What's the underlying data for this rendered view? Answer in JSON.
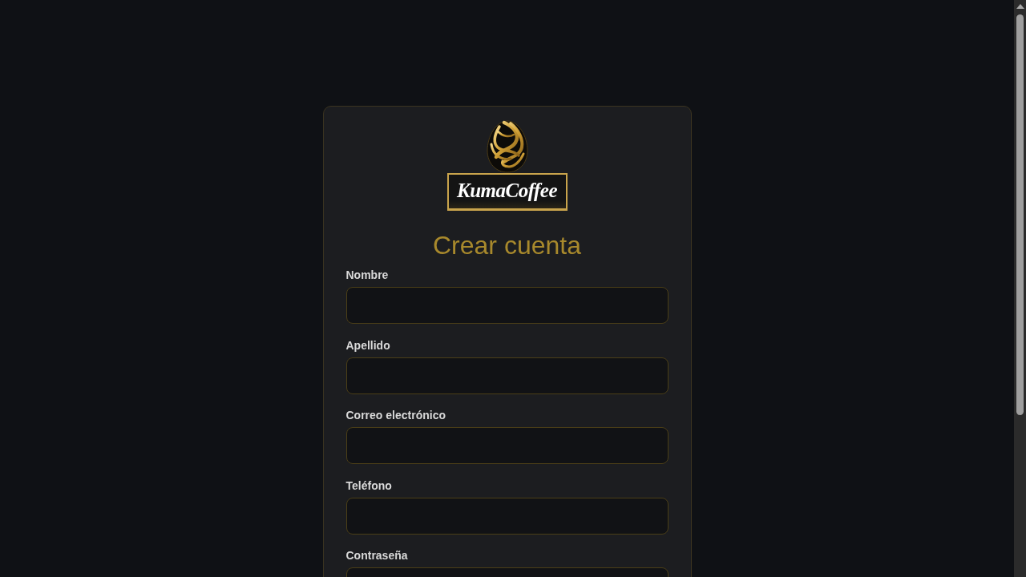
{
  "logo": {
    "wordmark": "KumaCoffee"
  },
  "title": "Crear cuenta",
  "fields": [
    {
      "label": "Nombre"
    },
    {
      "label": "Apellido"
    },
    {
      "label": "Correo electrónico"
    },
    {
      "label": "Teléfono"
    },
    {
      "label": "Contraseña"
    }
  ]
}
